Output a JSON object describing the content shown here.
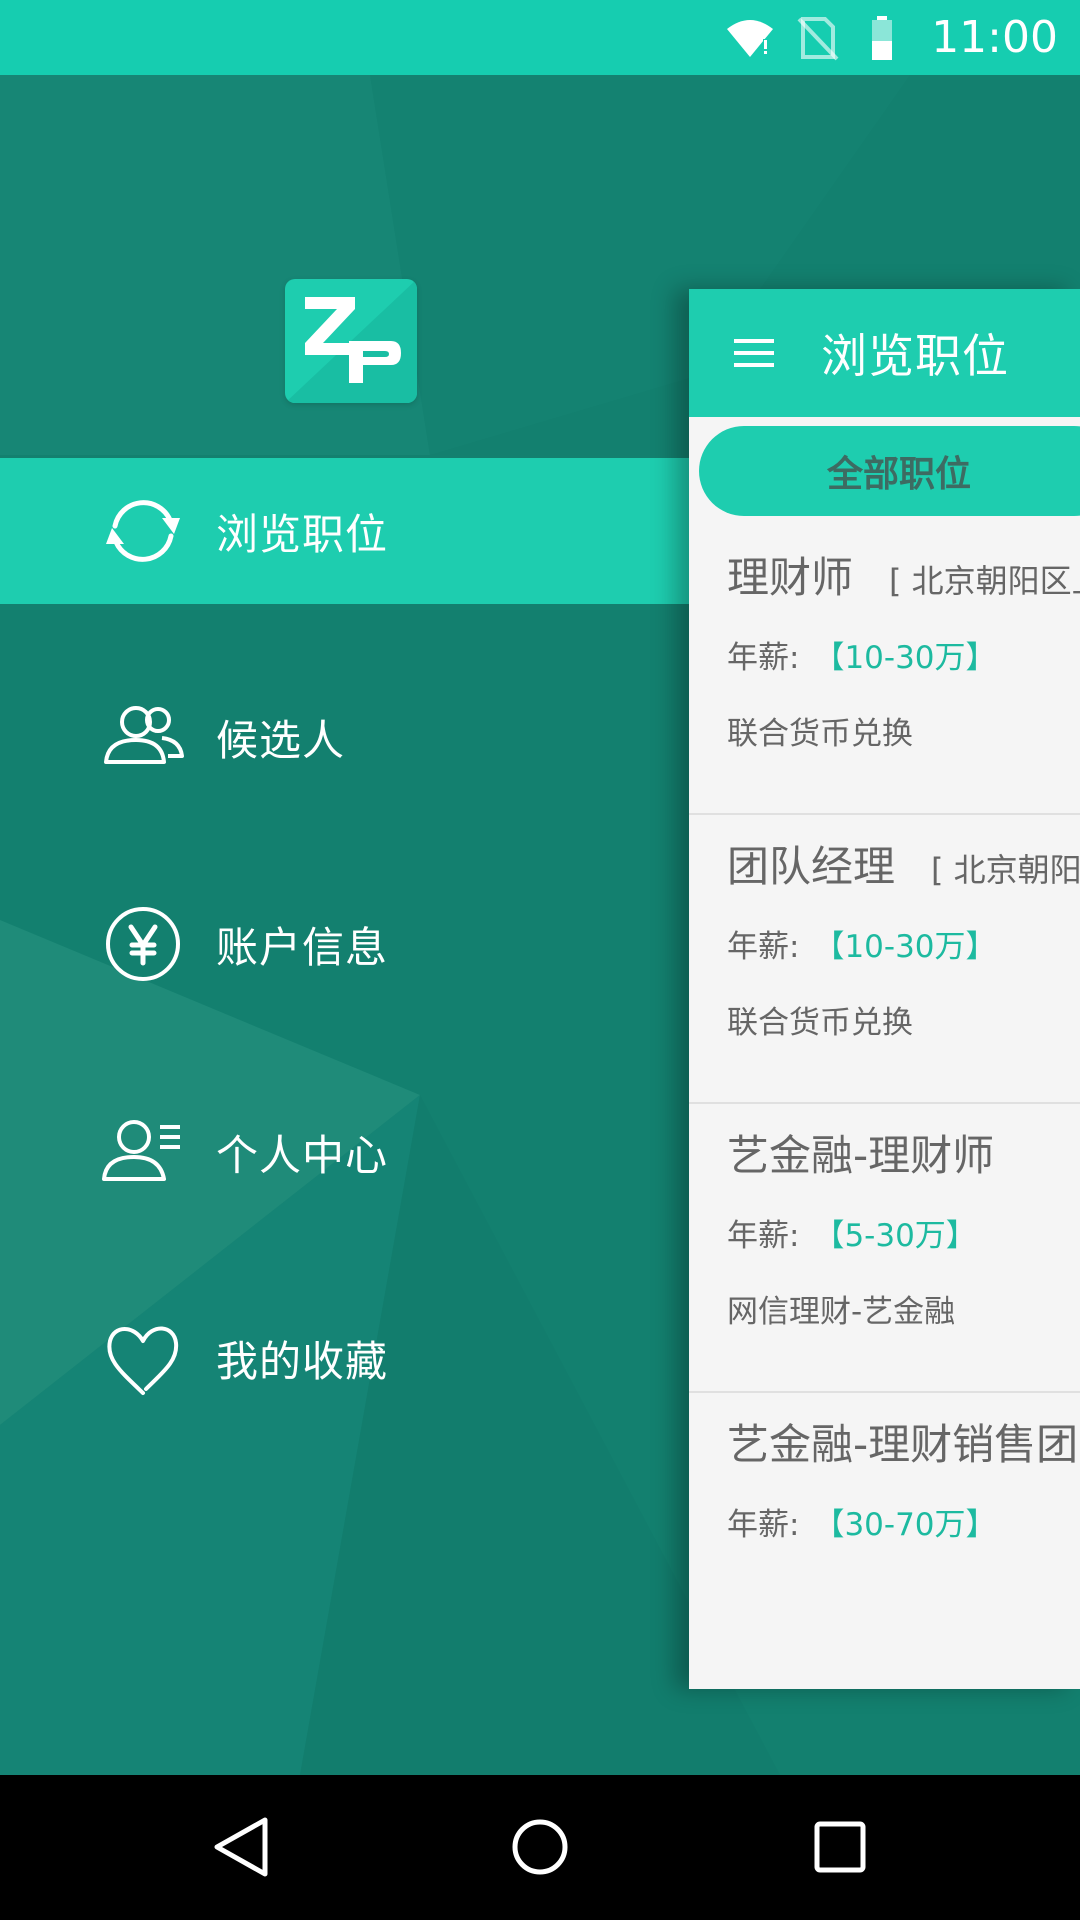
{
  "status_bar": {
    "time": "11:00",
    "icons": [
      "wifi-icon",
      "no-sim-icon",
      "battery-icon"
    ]
  },
  "colors": {
    "accent": "#1ecdaf",
    "status_bar": "#16cdb0",
    "drawer_background": "#13806f",
    "salary_text": "#1dbaa0",
    "panel_background": "#f5f5f5"
  },
  "drawer": {
    "logo_text": "ZP",
    "items": [
      {
        "label": "浏览职位",
        "icon": "refresh-icon",
        "active": true
      },
      {
        "label": "候选人",
        "icon": "users-icon",
        "active": false
      },
      {
        "label": "账户信息",
        "icon": "yen-icon",
        "active": false
      },
      {
        "label": "个人中心",
        "icon": "profile-icon",
        "active": false
      },
      {
        "label": "我的收藏",
        "icon": "heart-icon",
        "active": false
      }
    ]
  },
  "panel": {
    "title": "浏览职位",
    "menu_icon": "hamburger-icon",
    "filter": "全部职位",
    "jobs": [
      {
        "title": "理财师",
        "location": "[ 北京朝阳区上",
        "salary_label": "年薪:",
        "salary": "【10-30万】",
        "company": "联合货币兑换"
      },
      {
        "title": "团队经理",
        "location": "[ 北京朝阳区",
        "salary_label": "年薪:",
        "salary": "【10-30万】",
        "company": "联合货币兑换"
      },
      {
        "title": "艺金融-理财师",
        "location": "",
        "salary_label": "年薪:",
        "salary": "【5-30万】",
        "company": "网信理财-艺金融"
      },
      {
        "title": "艺金融-理财销售团队",
        "location": "",
        "salary_label": "年薪:",
        "salary": "【30-70万】",
        "company": ""
      }
    ]
  },
  "nav_bar": {
    "buttons": [
      "back-icon",
      "home-icon",
      "recents-icon"
    ]
  }
}
